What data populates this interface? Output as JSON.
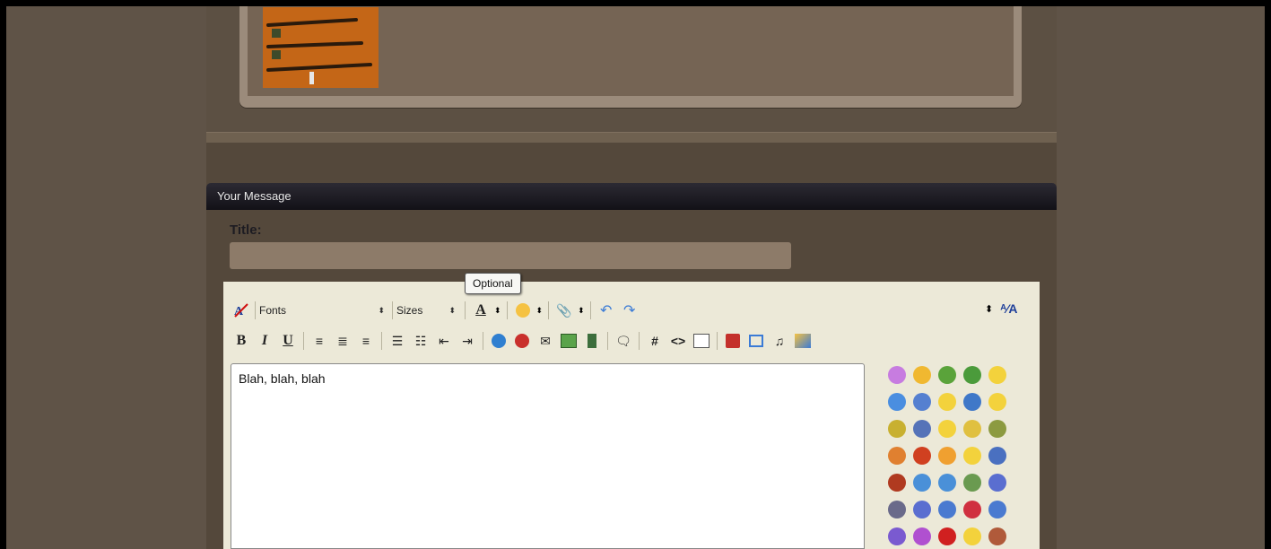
{
  "attachment": {
    "thumbnail": "rifles-photo"
  },
  "message_panel": {
    "header": "Your Message",
    "title_label": "Title:",
    "title_value": ""
  },
  "tooltip": "Optional",
  "toolbar": {
    "row1": {
      "fonts_label": "Fonts",
      "sizes_label": "Sizes"
    },
    "row2_icons": [
      "bold-icon",
      "italic-icon",
      "underline-icon",
      "align-left-icon",
      "align-center-icon",
      "align-right-icon",
      "ordered-list-icon",
      "unordered-list-icon",
      "outdent-icon",
      "indent-icon",
      "insert-link-icon",
      "remove-link-icon",
      "email-icon",
      "insert-image-icon",
      "insert-video-icon",
      "quote-icon",
      "wrap-code-icon",
      "wrap-html-icon",
      "wrap-php-icon",
      "youtube-icon",
      "media-icon",
      "music-icon",
      "gallery-icon"
    ]
  },
  "editor": {
    "text": "Blah, blah, blah"
  },
  "smilies": [
    "smiley-1",
    "smiley-2",
    "smiley-3",
    "smiley-4",
    "smiley-5",
    "smiley-6",
    "smiley-7",
    "smiley-8",
    "smiley-9",
    "smiley-10",
    "smiley-11",
    "smiley-12",
    "smiley-13",
    "smiley-14",
    "smiley-15",
    "smiley-16",
    "smiley-17",
    "smiley-18",
    "smiley-19",
    "smiley-20",
    "smiley-21",
    "smiley-22",
    "smiley-23",
    "smiley-24",
    "smiley-25",
    "smiley-26",
    "smiley-27",
    "smiley-28",
    "smiley-29",
    "smiley-30",
    "smiley-31",
    "smiley-32",
    "smiley-33",
    "smiley-34",
    "smiley-35"
  ],
  "colors": {
    "page_bg": "#5f5347",
    "column_bg": "#54483b",
    "header_bg": "#121117",
    "editor_bg": "#ece9d8",
    "title_input_bg": "#8d7b69"
  }
}
